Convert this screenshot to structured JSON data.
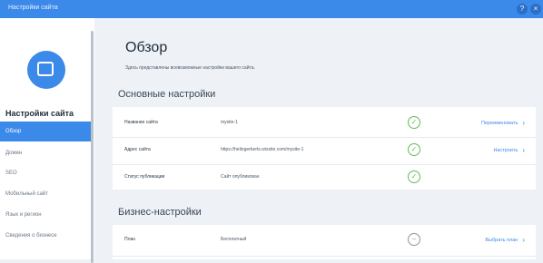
{
  "window": {
    "title": "Настройки сайта",
    "help_symbol": "?",
    "close_symbol": "×"
  },
  "sidebar": {
    "heading": "Настройки сайта",
    "items": [
      {
        "label": "Обзор"
      },
      {
        "label": "Домен"
      },
      {
        "label": "SEO"
      },
      {
        "label": "Мобильный сайт"
      },
      {
        "label": "Язык и регион"
      },
      {
        "label": "Сведения о бизнесе"
      }
    ]
  },
  "main": {
    "title": "Обзор",
    "subtitle": "Здесь представлены всевозможные настройки вашего сайта.",
    "general": {
      "title": "Основные настройки",
      "rows": [
        {
          "label": "Название сайта",
          "value": "mysite-1",
          "action": "Переименовать"
        },
        {
          "label": "Адрес сайта",
          "value": "https://helingerberts.wixsite.com/mysite-1",
          "action": "Настроить"
        },
        {
          "label": "Статус публикации",
          "value": "Сайт опубликован"
        }
      ]
    },
    "business": {
      "title": "Бизнес-настройки",
      "rows": [
        {
          "label": "План",
          "value": "Бесплатный",
          "action": "Выбрать план"
        }
      ]
    }
  },
  "icons": {
    "check": "✓",
    "pending": "–",
    "chevron": "›"
  },
  "colors": {
    "accent": "#3b89e8",
    "success": "#60bc57"
  }
}
